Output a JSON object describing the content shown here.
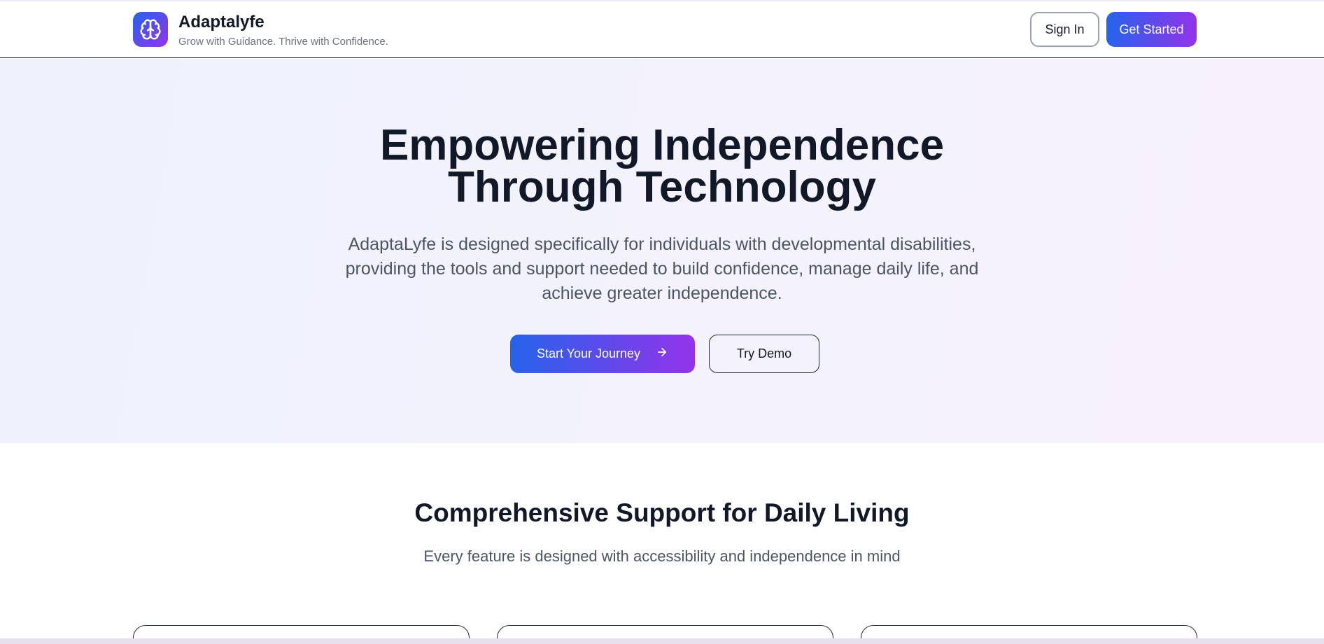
{
  "header": {
    "brand_name": "Adaptalyfe",
    "tagline": "Grow with Guidance. Thrive with Confidence.",
    "logo_icon": "brain-icon",
    "sign_in_label": "Sign In",
    "get_started_label": "Get Started"
  },
  "hero": {
    "title_line1": "Empowering Independence",
    "title_line2": "Through Technology",
    "subtitle": "AdaptaLyfe is designed specifically for individuals with developmental disabilities, providing the tools and support needed to build confidence, manage daily life, and achieve greater independence.",
    "primary_cta": "Start Your Journey",
    "primary_cta_icon": "arrow-right-icon",
    "secondary_cta": "Try Demo"
  },
  "features": {
    "title": "Comprehensive Support for Daily Living",
    "subtitle": "Every feature is designed with accessibility and independence in mind"
  },
  "colors": {
    "brand_gradient_start": "#2563eb",
    "brand_gradient_end": "#9333ea",
    "heading": "#111827",
    "body_text": "#4b5563"
  }
}
